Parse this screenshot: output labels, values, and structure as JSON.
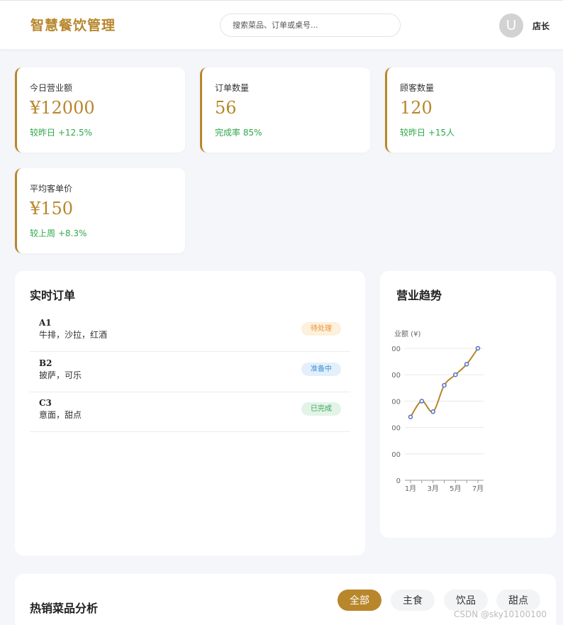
{
  "header": {
    "brand": "智慧餐饮管理",
    "search_placeholder": "搜索菜品、订单或桌号...",
    "avatar_letter": "U",
    "user_name": "店长"
  },
  "stats": [
    {
      "label": "今日营业额",
      "value": "¥12000",
      "trend": "较昨日 +12.5%"
    },
    {
      "label": "订单数量",
      "value": "56",
      "trend": "完成率 85%"
    },
    {
      "label": "顾客数量",
      "value": "120",
      "trend": "较昨日 +15人"
    },
    {
      "label": "平均客单价",
      "value": "¥150",
      "trend": "较上周 +8.3%"
    }
  ],
  "orders_panel": {
    "title": "实时订单",
    "orders": [
      {
        "table": "A1",
        "items": "牛排，沙拉，红酒",
        "status": "待处理",
        "status_color": "#e8963a",
        "status_bg": "#fdf0dc"
      },
      {
        "table": "B2",
        "items": "披萨，可乐",
        "status": "准备中",
        "status_color": "#3d8fd6",
        "status_bg": "#e3f0fb"
      },
      {
        "table": "C3",
        "items": "意面，甜点",
        "status": "已完成",
        "status_color": "#3aa55a",
        "status_bg": "#e3f4e7"
      }
    ]
  },
  "trend_panel": {
    "title": "营业趋势"
  },
  "chart_data": {
    "type": "line",
    "ylabel": "业额 (¥)",
    "y_ticks": [
      "00",
      "00",
      "00",
      "00",
      "00",
      "0"
    ],
    "x_tick_labels": [
      "1月",
      "3月",
      "5月",
      "7月"
    ],
    "x": [
      "1月",
      "2月",
      "3月",
      "4月",
      "5月",
      "6月",
      "7月"
    ],
    "values": [
      2.4,
      3.0,
      2.6,
      3.6,
      4.0,
      4.4,
      5.0
    ],
    "ylim": [
      0,
      5
    ],
    "grid": true,
    "line_color": "#b8862b",
    "point_color": "#5470c6"
  },
  "hot_dishes": {
    "title": "热销菜品分析",
    "filters": [
      "全部",
      "主食",
      "饮品",
      "甜点"
    ],
    "active_filter": "全部"
  },
  "watermark": "CSDN @sky10100100",
  "colors": {
    "accent": "#b8862b",
    "positive": "#2fa84a",
    "background": "#f5f6fa"
  }
}
